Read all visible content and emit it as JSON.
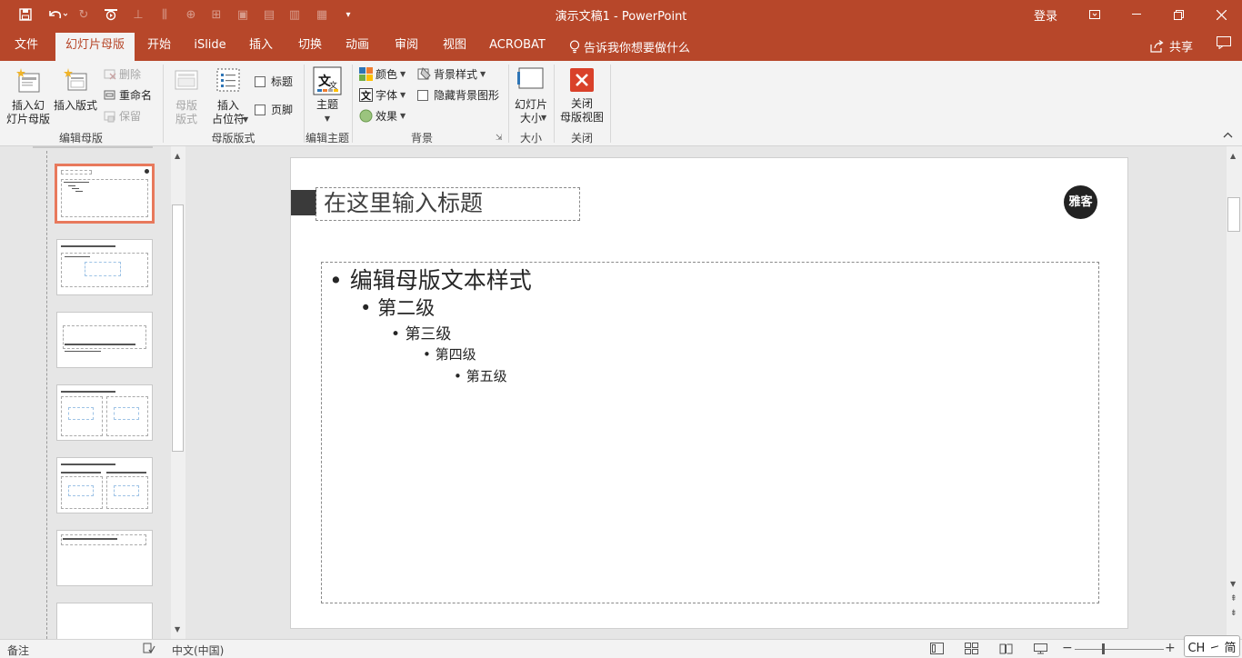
{
  "window": {
    "doc_title": "演示文稿1  -  PowerPoint",
    "login": "登录"
  },
  "tabs": [
    "文件",
    "幻灯片母版",
    "开始",
    "iSlide",
    "插入",
    "切换",
    "动画",
    "审阅",
    "视图",
    "ACROBAT"
  ],
  "active_tab": "幻灯片母版",
  "tell_me": "告诉我你想要做什么",
  "share": "共享",
  "ribbon": {
    "edit_master": {
      "insert_slide_master": "插入幻\n灯片母版",
      "insert_layout": "插入版式",
      "delete": "删除",
      "rename": "重命名",
      "preserve": "保留",
      "label": "编辑母版"
    },
    "master_layout": {
      "master_layout_btn": "母版\n版式",
      "insert_placeholder": "插入\n占位符",
      "title_check": "标题",
      "footer_check": "页脚",
      "label": "母版版式"
    },
    "edit_theme": {
      "themes": "主题",
      "label": "编辑主题"
    },
    "background": {
      "colors": "颜色",
      "fonts": "字体",
      "effects": "效果",
      "bg_styles": "背景样式",
      "hide_bg": "隐藏背景图形",
      "label": "背景"
    },
    "size": {
      "slide_size": "幻灯片\n大小",
      "label": "大小"
    },
    "close": {
      "close_master": "关闭\n母版视图",
      "label": "关闭"
    }
  },
  "slide": {
    "title_placeholder": "在这里输入标题",
    "logo_text": "雅客",
    "levels": [
      "编辑母版文本样式",
      "第二级",
      "第三级",
      "第四级",
      "第五级"
    ]
  },
  "status": {
    "notes": "备注",
    "language": "中文(中国)",
    "ime": "CH ㇀ 简"
  },
  "colors": {
    "accent": "#b7472a",
    "thumb_selected": "#e8795c"
  }
}
